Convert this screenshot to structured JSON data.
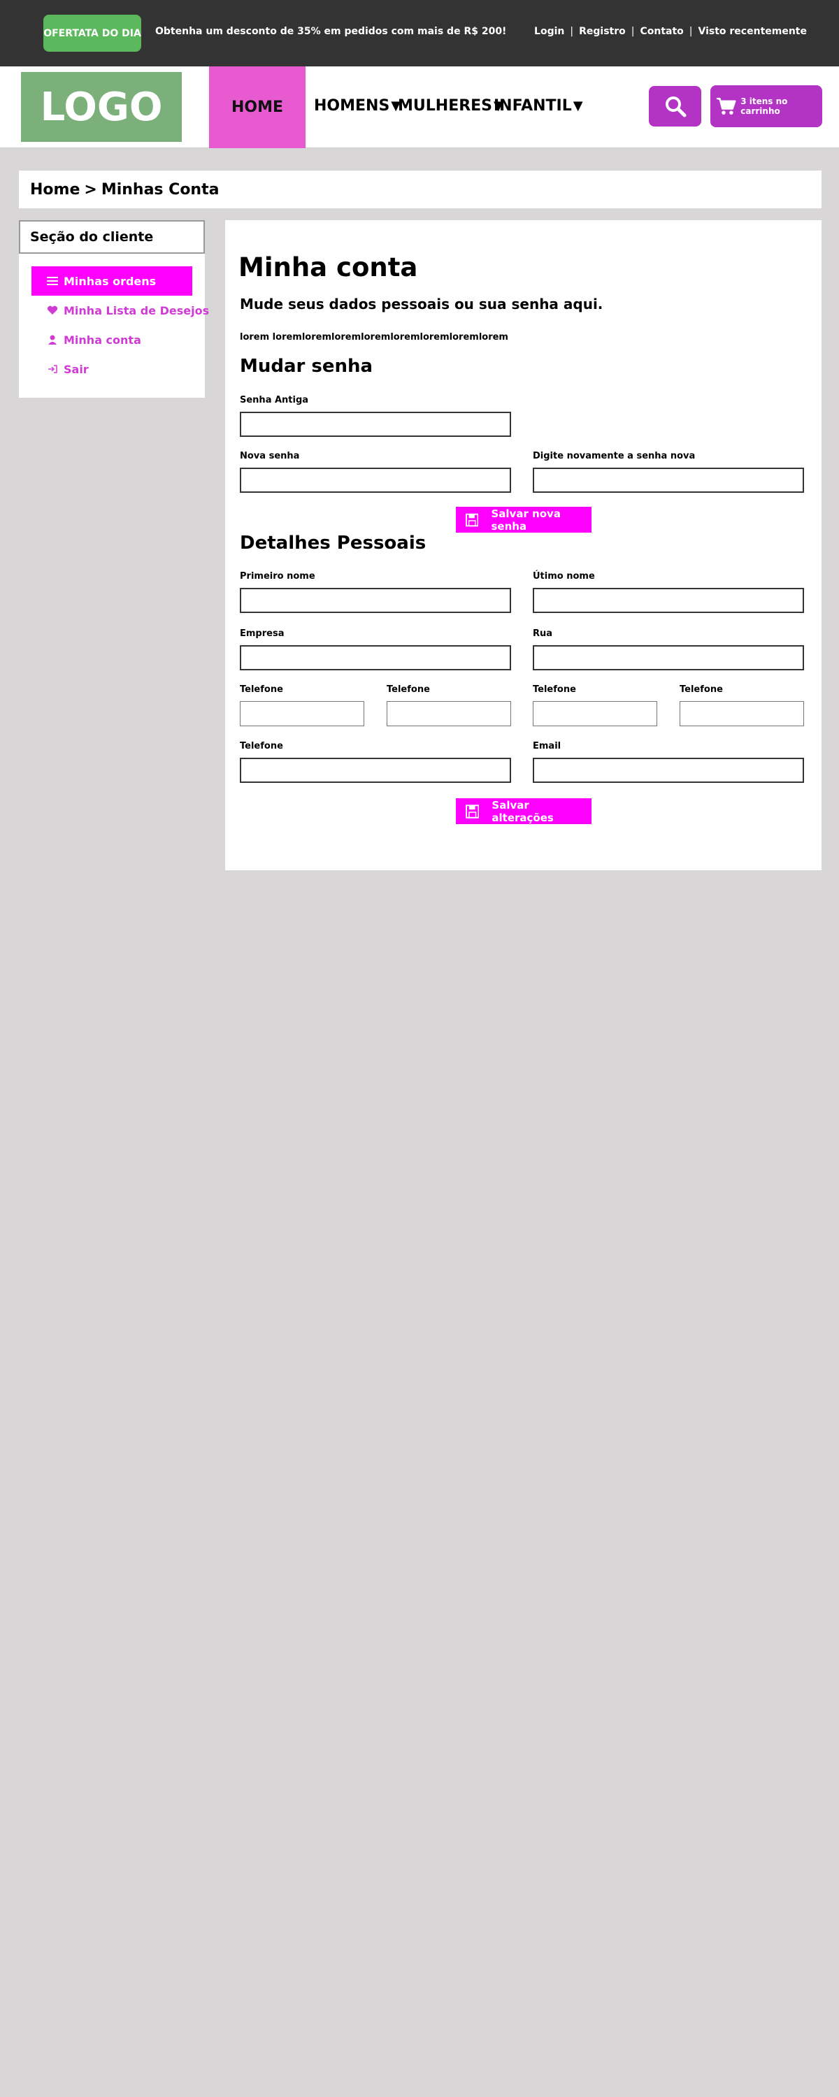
{
  "topbar": {
    "deal_badge": "OFERTATA DO DIA",
    "promo_text": "Obtenha um desconto de 35% em pedidos com mais de R$ 200!",
    "links": [
      "Login",
      "Registro",
      "Contato",
      "Visto recentemente"
    ],
    "separator": "|"
  },
  "header": {
    "logo": "LOGO",
    "nav": {
      "home": "HOME",
      "men": "HOMENS",
      "women": "MULHERES",
      "kids": "INFANTIL",
      "arrow": "▼"
    },
    "cart_label": "3 itens no carrinho"
  },
  "breadcrumb": {
    "home": "Home",
    "sep": ">",
    "current": "Minhas Conta"
  },
  "sidebar": {
    "title": "Seção do cliente",
    "items": [
      {
        "label": "Minhas ordens",
        "icon": "menu-icon",
        "active": true
      },
      {
        "label": "Minha Lista de Desejos",
        "icon": "heart-icon",
        "active": false
      },
      {
        "label": "Minha conta",
        "icon": "user-icon",
        "active": false
      },
      {
        "label": "Sair",
        "icon": "logout-icon",
        "active": false
      }
    ]
  },
  "main": {
    "title": "Minha conta",
    "subtitle": "Mude seus dados pessoais ou sua senha aqui.",
    "lorem": "lorem loremloremloremloremloremloremloremlorem",
    "password": {
      "title": "Mudar senha",
      "old_label": "Senha Antiga",
      "new_label": "Nova senha",
      "confirm_label": "Digite novamente a senha nova",
      "save_label": "Salvar nova senha"
    },
    "personal": {
      "title": "Detalhes Pessoais",
      "first_name": "Primeiro nome",
      "last_name": "Útimo nome",
      "company": "Empresa",
      "street": "Rua",
      "phone1": "Telefone",
      "phone2": "Telefone",
      "phone3": "Telefone",
      "phone4": "Telefone",
      "phone5": "Telefone",
      "email": "Email",
      "save_label": "Salvar alterações"
    }
  },
  "colors": {
    "topbar": "#333333",
    "deal": "#5cb85c",
    "logo": "#7bb07a",
    "home_nav": "#e85bd0",
    "buttons": "#b233c4",
    "accent": "#ff00ff",
    "sidebar_link": "#d13bd5",
    "background": "#d8d6d7"
  }
}
